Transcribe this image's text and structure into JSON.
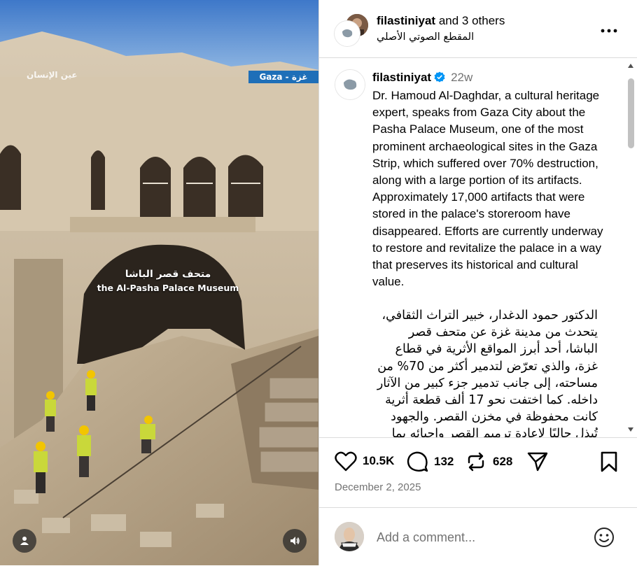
{
  "media": {
    "watermark": "عين الإنسان",
    "location_tag": "Gaza - غزة",
    "caption_ar": "متحف قصر الباشا",
    "caption_en": "the Al-Pasha Palace Museum",
    "user_icon": "person-icon",
    "audio_icon": "speaker-icon"
  },
  "header": {
    "username": "filastiniyat",
    "others": "and 3 others",
    "audio": "المقطع الصوتي الأصلي",
    "more_icon": "more-dots-icon"
  },
  "post": {
    "username": "filastiniyat",
    "age": "22w",
    "caption_en": "Dr. Hamoud Al-Daghdar, a cultural heritage expert, speaks from Gaza City about the Pasha Palace Museum, one of the most prominent archaeological sites in the Gaza Strip, which suffered over 70% destruction, along with a large portion of its artifacts. Approximately 17,000 artifacts that were stored in the palace's storeroom have disappeared. Efforts are currently underway to restore and revitalize the palace in a way that preserves its historical and cultural value.",
    "caption_ar": "الدكتور حمود الدغدار، خبير التراث الثقافي، يتحدث من مدينة غزة عن متحف قصر الباشا، أحد أبرز المواقع الأثرية في قطاع غزة، والذي تعرّض لتدمير أكثر من 70% من مساحته، إلى جانب تدمير جزء كبير من الآثار داخله. كما اختفت نحو 17 ألف قطعة أثرية كانت محفوظة في مخزن القصر. والجهود تُبذل حاليًا لإعادة ترميم القصر وإحيائه بما"
  },
  "actions": {
    "likes": "10.5K",
    "comments": "132",
    "reposts": "628",
    "icons": [
      "heart-icon",
      "comment-icon",
      "repost-icon",
      "share-icon",
      "bookmark-icon"
    ]
  },
  "date": "December 2, 2025",
  "comment": {
    "placeholder": "Add a comment...",
    "emoji_icon": "emoji-icon"
  },
  "colors": {
    "verified": "#0095f6",
    "secondary_text": "#737373",
    "divider": "#dbdbdb",
    "tag_bg": "#1e6fb8"
  }
}
